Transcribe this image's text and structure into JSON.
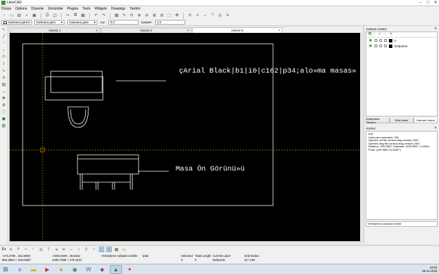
{
  "window": {
    "title": "LibreCAD",
    "minimize": "–",
    "maximize": "□",
    "close": "✕"
  },
  "menu": [
    "Dosya",
    "Options",
    "Düzenle",
    "Görüntüle",
    "Plugins",
    "Tools",
    "Widgets",
    "Drawings",
    "Yardım"
  ],
  "props": {
    "pen_color": "Katmana göre",
    "pen_width": "Katmana göre",
    "line_type": "Katmana göre",
    "angle_label": "Açı:",
    "angle_value": "0.0",
    "scale_label": "Çarpan:",
    "scale_value": "1.0"
  },
  "tabs": [
    {
      "label": "isimsiz 1",
      "active": false
    },
    {
      "label": "isimsiz 4",
      "active": false
    },
    {
      "label": "isimsiz 5",
      "active": true
    }
  ],
  "drawing": {
    "text_top": "çArial Black|b1|i0|c162|p34;alo»ma  masas»",
    "text_bottom": "Masa Ön Görünü»ü"
  },
  "layers": {
    "title": "Katman Listesi",
    "rows": [
      {
        "name": "0"
      },
      {
        "name": "Defpoints"
      }
    ]
  },
  "panel_tabs": [
    {
      "label": "Kütüphane Tarayıcı",
      "active": false
    },
    {
      "label": "Blok listesi",
      "active": false
    },
    {
      "label": "Katman Listesi",
      "active": true
    }
  ],
  "command": {
    "title": "Komut",
    "lines": [
      "200",
      "Unknown command: 200",
      "Opened dxf file version dwg version 2007.",
      "Opened dwg file version dwg version 2007.",
      "Distance: 299.9857 Cartesian: (299.9857, 0.0000),",
      "Polar: (299.9857<0.0000°)"
    ],
    "input_hint": "Yerleştirme noktasını belirle"
  },
  "snap": {
    "label": "Ex"
  },
  "status": {
    "coord_abs_1": "-174.4706 , 151.9080",
    "coord_abs_2": "966.2564 < 100.5259°",
    "coord_rel_1": "-2403.4649 , 35.6442",
    "coord_rel_2": "2405.7488 < 179.1511°",
    "hint": "Yerleştirme noktasını belirle",
    "cancel": "İptal",
    "selected_label": "Selected",
    "selected_value": "0",
    "total_length_label": "Total Length",
    "total_length_value": "0",
    "current_layer_label": "Current Layer",
    "current_layer_value": "Defpoints",
    "grid_label": "Grid Status",
    "grid_value": "10 / 100"
  },
  "taskbar": {
    "time": "16:50",
    "date": "05.01.2018"
  }
}
